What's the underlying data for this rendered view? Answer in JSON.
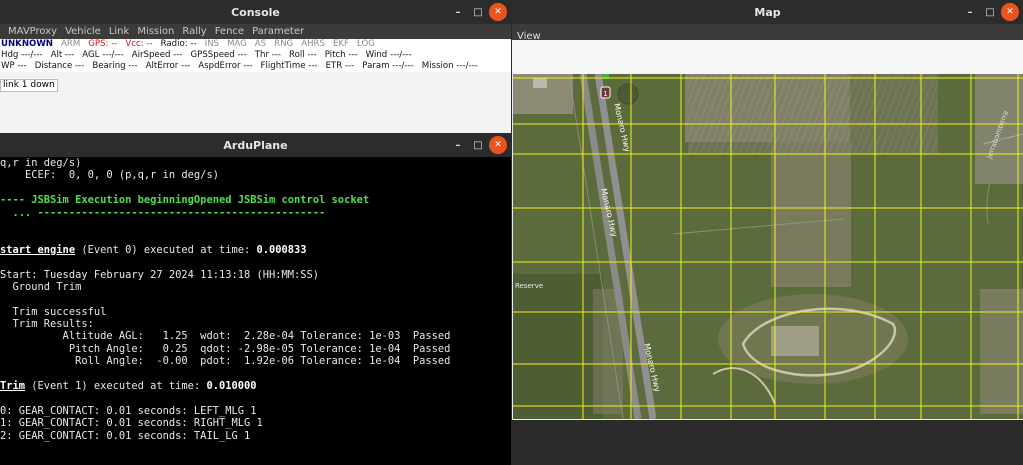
{
  "console": {
    "title": "Console",
    "menu": [
      "MAVProxy",
      "Vehicle",
      "Link",
      "Mission",
      "Rally",
      "Fence",
      "Parameter"
    ],
    "status_row1": [
      {
        "text": "UNKNOWN",
        "style": "navy"
      },
      {
        "text": "ARM",
        "style": "gray"
      },
      {
        "text": "GPS: --",
        "style": "red"
      },
      {
        "text": "Vcc: --",
        "style": "red"
      },
      {
        "text": "Radio: --",
        "style": "plain"
      },
      {
        "text": "INS",
        "style": "gray"
      },
      {
        "text": "MAG",
        "style": "gray"
      },
      {
        "text": "AS",
        "style": "gray"
      },
      {
        "text": "RNG",
        "style": "gray"
      },
      {
        "text": "AHRS",
        "style": "gray"
      },
      {
        "text": "EKF",
        "style": "gray"
      },
      {
        "text": "LOG",
        "style": "gray"
      }
    ],
    "status_row2": [
      "Hdg ---/---",
      "Alt ---",
      "AGL ---/---",
      "AirSpeed ---",
      "GPSSpeed ---",
      "Thr ---",
      "Roll ---",
      "Pitch ---",
      "Wind ---/---"
    ],
    "status_row3": [
      "WP ---",
      "Distance ---",
      "Bearing ---",
      "AltError ---",
      "AspdError ---",
      "FlightTime ---",
      "ETR ---",
      "Param ---/---",
      "Mission ---/---"
    ],
    "log_line": "link 1 down"
  },
  "ardu": {
    "title": "ArduPlane",
    "lines": [
      {
        "t": "q,r in deg/s)"
      },
      {
        "t": "    ECEF:  0, 0, 0 (p,q,r in deg/s)"
      },
      {
        "t": ""
      },
      {
        "t": "---- JSBSim Execution beginningOpened JSBSim control socket",
        "cls": "g"
      },
      {
        "t": "  ... ----------------------------------------------",
        "cls": "g"
      },
      {
        "t": ""
      },
      {
        "t": ""
      },
      {
        "parts": [
          {
            "t": "start engine",
            "cls": "u"
          },
          {
            "t": " (Event 0) executed at time: "
          },
          {
            "t": "0.000833",
            "cls": "b"
          }
        ]
      },
      {
        "t": ""
      },
      {
        "t": "Start: Tuesday February 27 2024 11:13:18 (HH:MM:SS)"
      },
      {
        "t": "  Ground Trim"
      },
      {
        "t": ""
      },
      {
        "t": "  Trim successful"
      },
      {
        "t": "  Trim Results:"
      },
      {
        "t": "          Altitude AGL:   1.25  wdot:  2.28e-04 Tolerance: 1e-03  Passed"
      },
      {
        "t": "           Pitch Angle:   0.25  qdot: -2.98e-05 Tolerance: 1e-04  Passed"
      },
      {
        "t": "            Roll Angle:  -0.00  pdot:  1.92e-06 Tolerance: 1e-04  Passed"
      },
      {
        "t": ""
      },
      {
        "parts": [
          {
            "t": "Trim",
            "cls": "u"
          },
          {
            "t": " (Event 1) executed at time: "
          },
          {
            "t": "0.010000",
            "cls": "b"
          }
        ]
      },
      {
        "t": ""
      },
      {
        "t": "0: GEAR_CONTACT: 0.01 seconds: LEFT_MLG 1"
      },
      {
        "t": "1: GEAR_CONTACT: 0.01 seconds: RIGHT_MLG 1"
      },
      {
        "t": "2: GEAR_CONTACT: 0.01 seconds: TAIL_LG 1"
      }
    ]
  },
  "map": {
    "title": "Map",
    "menu_view": "View",
    "road_labels": [
      "Monaro Hwy",
      "Monaro Hwy",
      "Monaro Hwy",
      "Monaro Hwy"
    ],
    "area_label": "Reserve",
    "side_label": "Jerrabomberra",
    "shield_label": "1",
    "colors": {
      "grid": "#f2f21a",
      "terrain": "#5d6e3e"
    }
  },
  "window_controls": {
    "minimize": "–",
    "maximize": "□",
    "close": "✕"
  }
}
